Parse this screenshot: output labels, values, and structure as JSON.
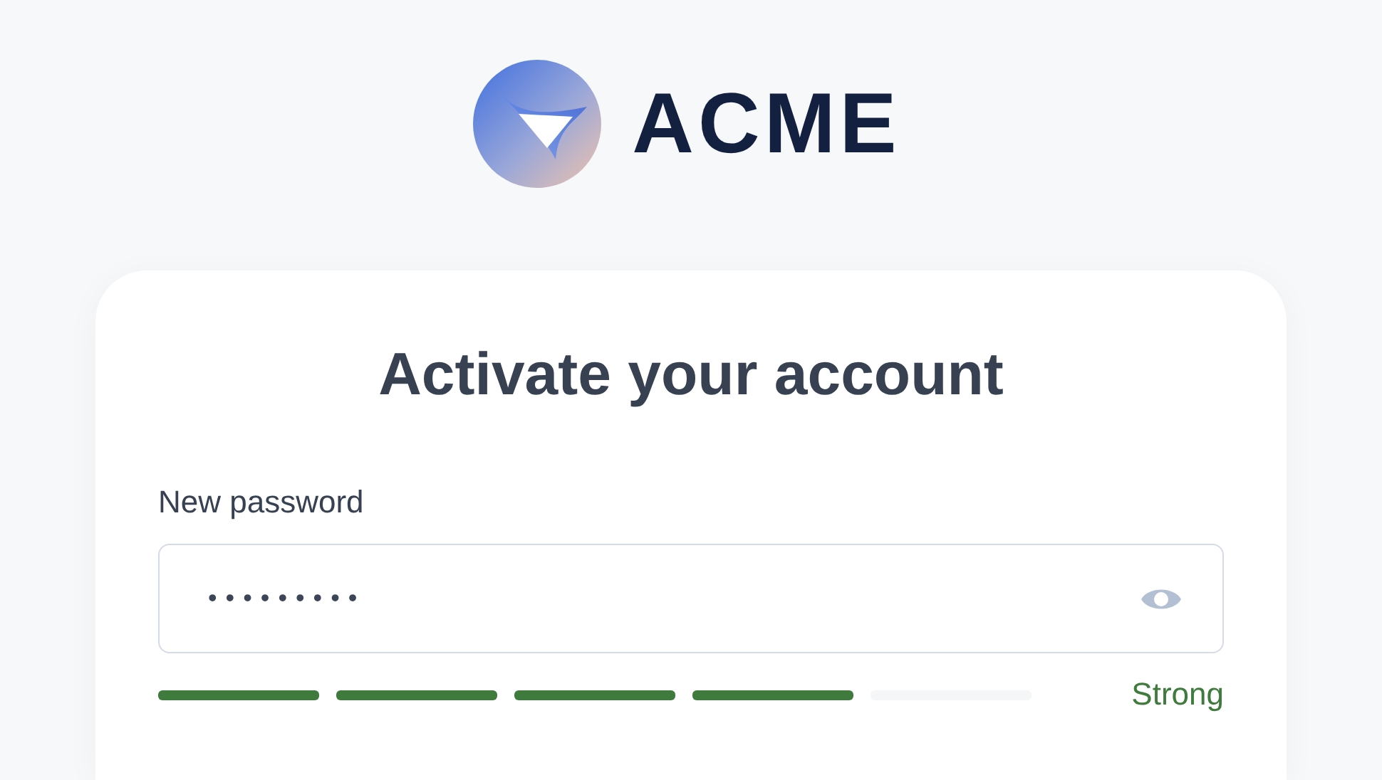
{
  "logo": {
    "text": "ACME"
  },
  "card": {
    "title": "Activate your account",
    "password": {
      "label": "New password",
      "value": "•••••••••",
      "revealed": false
    },
    "strength": {
      "level": 0.8,
      "label": "Strong"
    }
  }
}
